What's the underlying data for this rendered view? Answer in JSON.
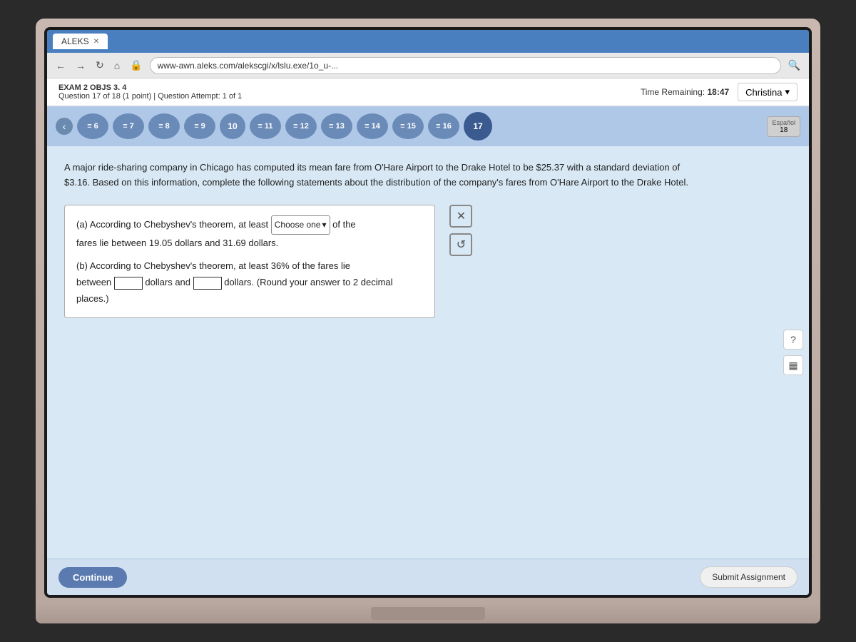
{
  "browser": {
    "tab_label": "ALEKS",
    "address": "www-awn.aleks.com/alekscgi/x/lslu.exe/1o_u-..."
  },
  "header": {
    "exam_label": "EXAM 2 OBJS 3. 4",
    "question_info": "Question 17 of 18 (1 point)  |  Question Attempt: 1 of 1",
    "time_label": "Time Remaining:",
    "time_value": "18:47",
    "user_name": "Christina",
    "espanol_label": "Español",
    "espanol_number": "18"
  },
  "nav": {
    "left_arrow": "‹",
    "right_arrow": "›",
    "questions": [
      {
        "label": "≡ 6",
        "current": false
      },
      {
        "label": "≡ 7",
        "current": false
      },
      {
        "label": "≡ 8",
        "current": false
      },
      {
        "label": "≡ 9",
        "current": false
      },
      {
        "label": "10",
        "current": false
      },
      {
        "label": "≡ 11",
        "current": false
      },
      {
        "label": "≡ 12",
        "current": false
      },
      {
        "label": "≡ 13",
        "current": false
      },
      {
        "label": "≡ 14",
        "current": false
      },
      {
        "label": "≡ 15",
        "current": false
      },
      {
        "label": "≡ 16",
        "current": false
      },
      {
        "label": "17",
        "current": true
      },
      {
        "label": "18",
        "current": false
      }
    ]
  },
  "question": {
    "body": "A major ride-sharing company in Chicago has computed its mean fare from O'Hare Airport to the Drake Hotel to be $25.37 with a standard deviation of $3.16. Based on this information, complete the following statements about the distribution of the company's fares from O'Hare Airport to the Drake Hotel.",
    "part_a_prefix": "(a) According to Chebyshev's theorem, at least",
    "part_a_select": "Choose one",
    "part_a_suffix": "of the",
    "part_a_line2": "fares lie between 19.05 dollars and 31.69 dollars.",
    "part_b_prefix": "(b) According to Chebyshev's theorem, at least 36% of the fares lie",
    "part_b_line2_prefix": "between",
    "part_b_line2_input1": "",
    "part_b_line2_mid": "dollars and",
    "part_b_line2_input2": "",
    "part_b_line2_suffix": "dollars.  (Round your answer to 2 decimal",
    "part_b_line3": "places.)"
  },
  "buttons": {
    "x_label": "✕",
    "redo_label": "↺",
    "continue_label": "Continue",
    "submit_label": "Submit Assignment",
    "help_label": "?",
    "calc_label": "▦"
  }
}
